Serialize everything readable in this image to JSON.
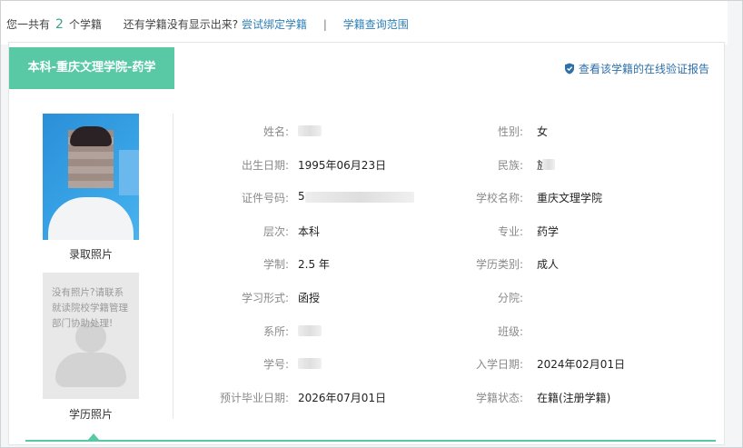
{
  "summary": {
    "prefix": "您一共有",
    "count": "2",
    "suffix": "个学籍",
    "question": "还有学籍没有显示出来?",
    "bind_link": "尝试绑定学籍",
    "separator": "|",
    "scope_link": "学籍查询范围"
  },
  "record": {
    "title": "本科-重庆文理学院-药学",
    "verify_link": "查看该学籍的在线验证报告",
    "admission_photo_caption": "录取照片",
    "diploma_photo_caption": "学历照片",
    "no_photo_note": "没有照片?请联系就读院校学籍管理部门协助处理!"
  },
  "left_fields": [
    {
      "label": "姓名:",
      "value": "",
      "redacted": true
    },
    {
      "label": "出生日期:",
      "value": "1995年06月23日"
    },
    {
      "label": "证件号码:",
      "value": "5",
      "redacted": true
    },
    {
      "label": "层次:",
      "value": "本科"
    },
    {
      "label": "学制:",
      "value": "2.5 年"
    },
    {
      "label": "学习形式:",
      "value": "函授"
    },
    {
      "label": "系所:",
      "value": "",
      "redacted": true
    },
    {
      "label": "学号:",
      "value": "",
      "redacted": true
    },
    {
      "label": "预计毕业日期:",
      "value": "2026年07月01日"
    }
  ],
  "right_fields": [
    {
      "label": "性别:",
      "value": "女"
    },
    {
      "label": "民族:",
      "value": "族",
      "redacted": true
    },
    {
      "label": "学校名称:",
      "value": "重庆文理学院"
    },
    {
      "label": "专业:",
      "value": "药学"
    },
    {
      "label": "学历类别:",
      "value": "成人"
    },
    {
      "label": "分院:",
      "value": ""
    },
    {
      "label": "班级:",
      "value": ""
    },
    {
      "label": "入学日期:",
      "value": "2024年02月01日"
    },
    {
      "label": "学籍状态:",
      "value": "在籍(注册学籍)"
    }
  ],
  "colors": {
    "accent": "#58c9a4",
    "link": "#2e7fb8",
    "count": "#3aa58a"
  }
}
